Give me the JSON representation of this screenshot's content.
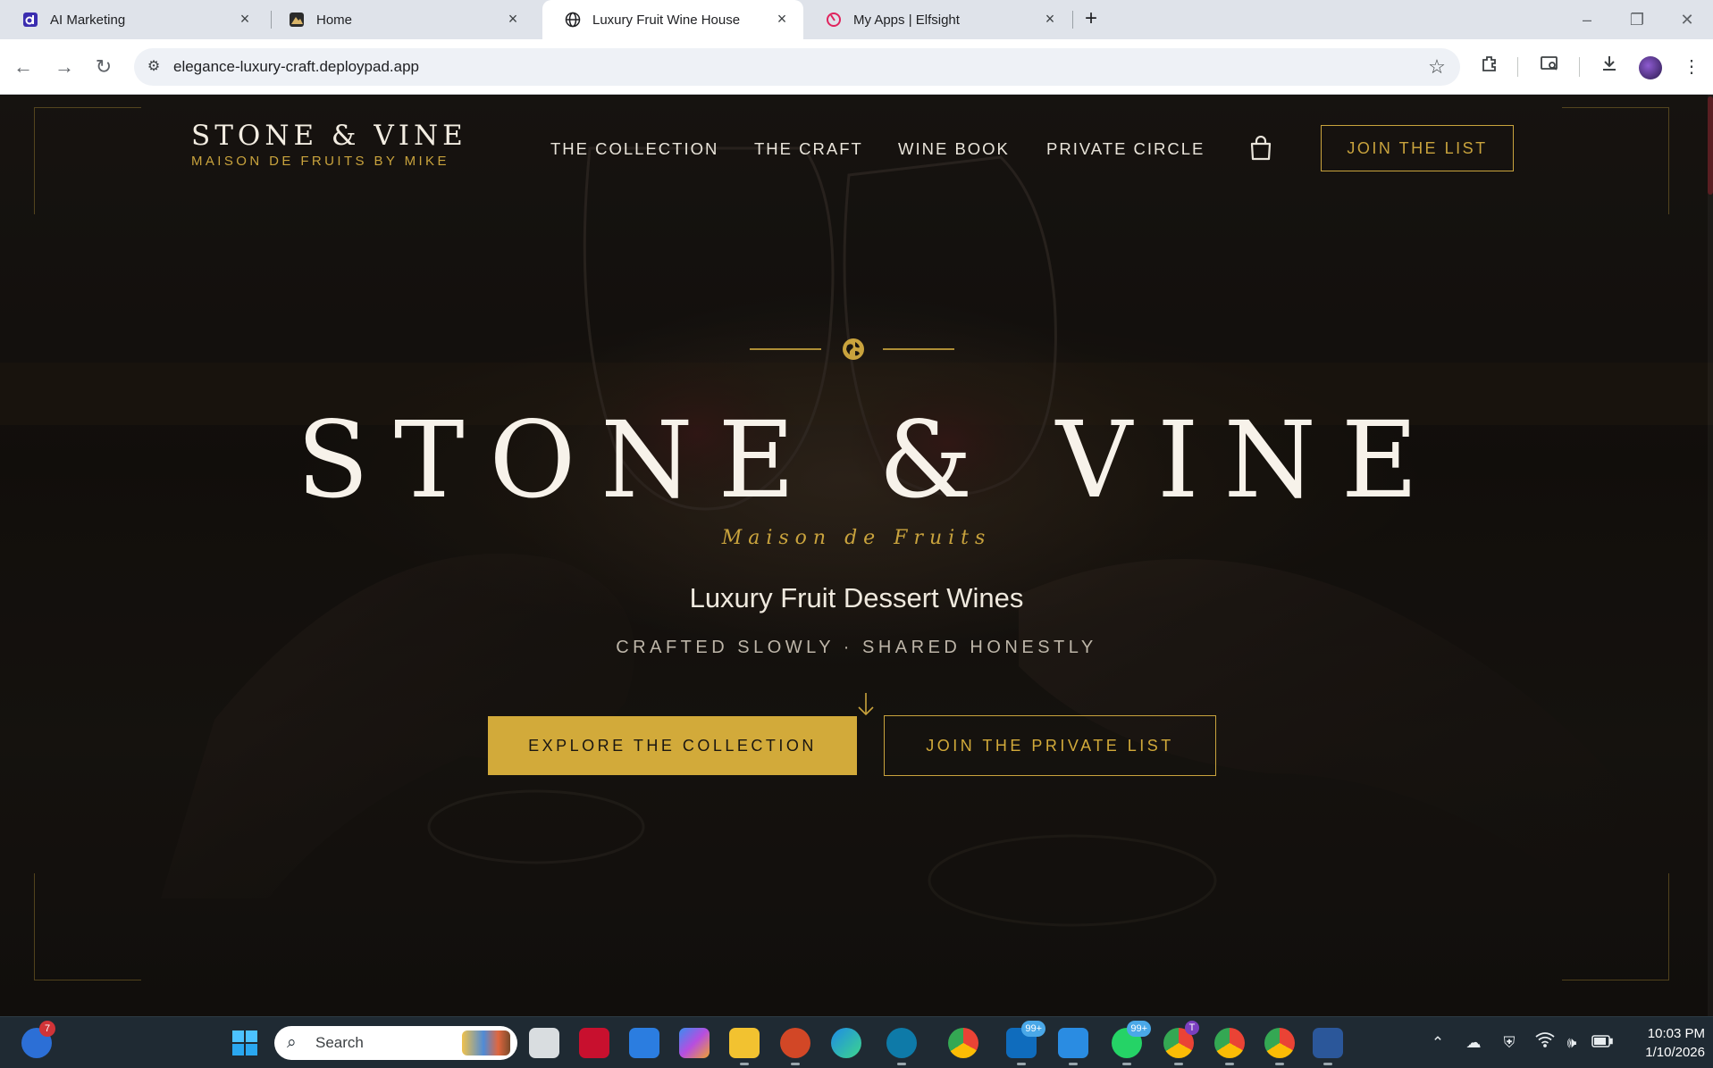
{
  "browser": {
    "tabs": [
      {
        "title": "AI Marketing",
        "icon": "d-logo-icon",
        "active": false
      },
      {
        "title": "Home",
        "icon": "mountain-photo-icon",
        "active": false
      },
      {
        "title": "Luxury Fruit Wine House",
        "icon": "globe-icon",
        "active": true
      },
      {
        "title": "My Apps | Elfsight",
        "icon": "elfsight-icon",
        "active": false
      }
    ],
    "url": "elegance-luxury-craft.deploypad.app"
  },
  "site": {
    "brand": {
      "name": "STONE & VINE",
      "tagline": "MAISON DE FRUITS BY MIKE"
    },
    "nav": [
      "THE COLLECTION",
      "THE CRAFT",
      "WINE BOOK",
      "PRIVATE CIRCLE"
    ],
    "join_button": "JOIN THE LIST",
    "hero": {
      "title": "STONE & VINE",
      "script": "Maison de Fruits",
      "subtitle": "Luxury Fruit Dessert Wines",
      "tagline": "CRAFTED SLOWLY · SHARED HONESTLY",
      "primary_cta": "EXPLORE THE COLLECTION",
      "secondary_cta": "JOIN THE PRIVATE LIST"
    },
    "colors": {
      "gold": "#c9a33d",
      "background": "#17130f",
      "text": "#f3ede2"
    }
  },
  "taskbar": {
    "search_label": "Search",
    "chat_badge": "7",
    "outlook_badge": "99+",
    "whatsapp_badge": "99+",
    "chrome_profile_badge": "T",
    "time": "10:03 PM",
    "date": "1/10/2026"
  }
}
